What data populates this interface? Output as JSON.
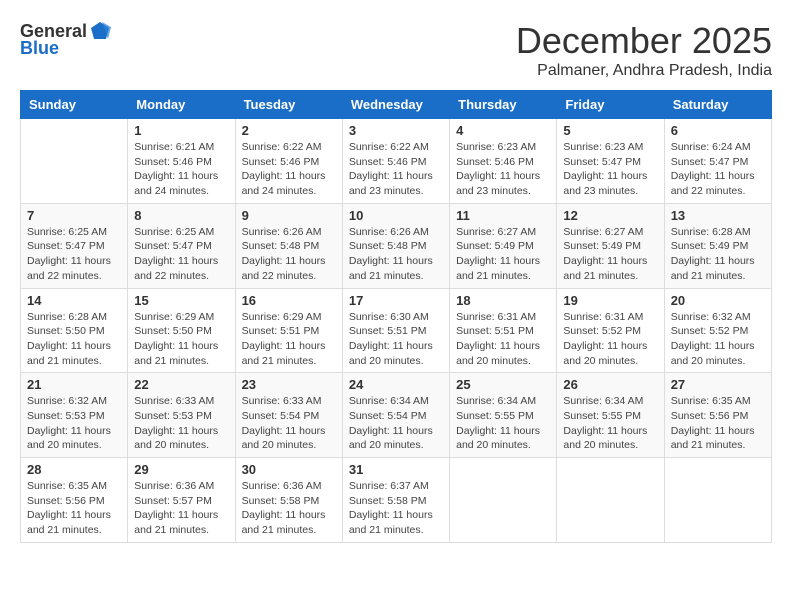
{
  "logo": {
    "general": "General",
    "blue": "Blue"
  },
  "title": "December 2025",
  "subtitle": "Palmaner, Andhra Pradesh, India",
  "days_header": [
    "Sunday",
    "Monday",
    "Tuesday",
    "Wednesday",
    "Thursday",
    "Friday",
    "Saturday"
  ],
  "weeks": [
    [
      {
        "day": "",
        "info": ""
      },
      {
        "day": "1",
        "info": "Sunrise: 6:21 AM\nSunset: 5:46 PM\nDaylight: 11 hours and 24 minutes."
      },
      {
        "day": "2",
        "info": "Sunrise: 6:22 AM\nSunset: 5:46 PM\nDaylight: 11 hours and 24 minutes."
      },
      {
        "day": "3",
        "info": "Sunrise: 6:22 AM\nSunset: 5:46 PM\nDaylight: 11 hours and 23 minutes."
      },
      {
        "day": "4",
        "info": "Sunrise: 6:23 AM\nSunset: 5:46 PM\nDaylight: 11 hours and 23 minutes."
      },
      {
        "day": "5",
        "info": "Sunrise: 6:23 AM\nSunset: 5:47 PM\nDaylight: 11 hours and 23 minutes."
      },
      {
        "day": "6",
        "info": "Sunrise: 6:24 AM\nSunset: 5:47 PM\nDaylight: 11 hours and 22 minutes."
      }
    ],
    [
      {
        "day": "7",
        "info": "Sunrise: 6:25 AM\nSunset: 5:47 PM\nDaylight: 11 hours and 22 minutes."
      },
      {
        "day": "8",
        "info": "Sunrise: 6:25 AM\nSunset: 5:47 PM\nDaylight: 11 hours and 22 minutes."
      },
      {
        "day": "9",
        "info": "Sunrise: 6:26 AM\nSunset: 5:48 PM\nDaylight: 11 hours and 22 minutes."
      },
      {
        "day": "10",
        "info": "Sunrise: 6:26 AM\nSunset: 5:48 PM\nDaylight: 11 hours and 21 minutes."
      },
      {
        "day": "11",
        "info": "Sunrise: 6:27 AM\nSunset: 5:49 PM\nDaylight: 11 hours and 21 minutes."
      },
      {
        "day": "12",
        "info": "Sunrise: 6:27 AM\nSunset: 5:49 PM\nDaylight: 11 hours and 21 minutes."
      },
      {
        "day": "13",
        "info": "Sunrise: 6:28 AM\nSunset: 5:49 PM\nDaylight: 11 hours and 21 minutes."
      }
    ],
    [
      {
        "day": "14",
        "info": "Sunrise: 6:28 AM\nSunset: 5:50 PM\nDaylight: 11 hours and 21 minutes."
      },
      {
        "day": "15",
        "info": "Sunrise: 6:29 AM\nSunset: 5:50 PM\nDaylight: 11 hours and 21 minutes."
      },
      {
        "day": "16",
        "info": "Sunrise: 6:29 AM\nSunset: 5:51 PM\nDaylight: 11 hours and 21 minutes."
      },
      {
        "day": "17",
        "info": "Sunrise: 6:30 AM\nSunset: 5:51 PM\nDaylight: 11 hours and 20 minutes."
      },
      {
        "day": "18",
        "info": "Sunrise: 6:31 AM\nSunset: 5:51 PM\nDaylight: 11 hours and 20 minutes."
      },
      {
        "day": "19",
        "info": "Sunrise: 6:31 AM\nSunset: 5:52 PM\nDaylight: 11 hours and 20 minutes."
      },
      {
        "day": "20",
        "info": "Sunrise: 6:32 AM\nSunset: 5:52 PM\nDaylight: 11 hours and 20 minutes."
      }
    ],
    [
      {
        "day": "21",
        "info": "Sunrise: 6:32 AM\nSunset: 5:53 PM\nDaylight: 11 hours and 20 minutes."
      },
      {
        "day": "22",
        "info": "Sunrise: 6:33 AM\nSunset: 5:53 PM\nDaylight: 11 hours and 20 minutes."
      },
      {
        "day": "23",
        "info": "Sunrise: 6:33 AM\nSunset: 5:54 PM\nDaylight: 11 hours and 20 minutes."
      },
      {
        "day": "24",
        "info": "Sunrise: 6:34 AM\nSunset: 5:54 PM\nDaylight: 11 hours and 20 minutes."
      },
      {
        "day": "25",
        "info": "Sunrise: 6:34 AM\nSunset: 5:55 PM\nDaylight: 11 hours and 20 minutes."
      },
      {
        "day": "26",
        "info": "Sunrise: 6:34 AM\nSunset: 5:55 PM\nDaylight: 11 hours and 20 minutes."
      },
      {
        "day": "27",
        "info": "Sunrise: 6:35 AM\nSunset: 5:56 PM\nDaylight: 11 hours and 21 minutes."
      }
    ],
    [
      {
        "day": "28",
        "info": "Sunrise: 6:35 AM\nSunset: 5:56 PM\nDaylight: 11 hours and 21 minutes."
      },
      {
        "day": "29",
        "info": "Sunrise: 6:36 AM\nSunset: 5:57 PM\nDaylight: 11 hours and 21 minutes."
      },
      {
        "day": "30",
        "info": "Sunrise: 6:36 AM\nSunset: 5:58 PM\nDaylight: 11 hours and 21 minutes."
      },
      {
        "day": "31",
        "info": "Sunrise: 6:37 AM\nSunset: 5:58 PM\nDaylight: 11 hours and 21 minutes."
      },
      {
        "day": "",
        "info": ""
      },
      {
        "day": "",
        "info": ""
      },
      {
        "day": "",
        "info": ""
      }
    ]
  ]
}
